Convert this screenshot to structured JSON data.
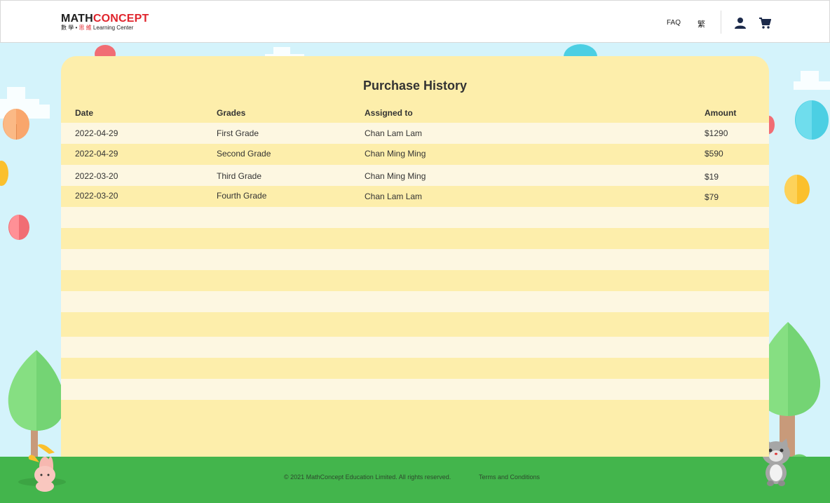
{
  "header": {
    "logo": {
      "main_a": "Math",
      "main_b": "Concept",
      "sub_a": "數 學 • ",
      "sub_b": "思 維",
      "sub_c": " Learning Center"
    },
    "nav": {
      "faq": "FAQ",
      "language": "繁"
    }
  },
  "page": {
    "title": "Purchase History",
    "columns": [
      "Date",
      "Grades",
      "Assigned to",
      "Amount"
    ],
    "rows": [
      {
        "date": "2022-04-29",
        "grade": "First Grade",
        "assigned_to": "Chan Lam Lam",
        "amount": "$1290"
      },
      {
        "date": "2022-04-29",
        "grade": "Second Grade",
        "assigned_to": "Chan Ming Ming",
        "amount": "$590"
      },
      {
        "date": "2022-03-20",
        "grade": "Third Grade",
        "assigned_to": "Chan Ming Ming",
        "amount": "$19"
      },
      {
        "date": "2022-03-20",
        "grade": "Fourth Grade",
        "assigned_to": "Chan Lam Lam",
        "amount": "$79"
      }
    ]
  },
  "footer": {
    "copyright": "© 2021 MathConcept Education Limited. All rights reserved.",
    "terms": "Terms and Conditions"
  },
  "colors": {
    "sky": "#d4f3fb",
    "card": "#fdeeab",
    "stripe_light": "#fdf7e1",
    "ground": "#43b54c",
    "brand_red": "#e0242c"
  },
  "icons": [
    "user-icon",
    "cart-icon",
    "balloon-icon",
    "tree-icon",
    "bush-icon",
    "cloud-icon",
    "rabbit-mascot",
    "cat-mascot"
  ]
}
